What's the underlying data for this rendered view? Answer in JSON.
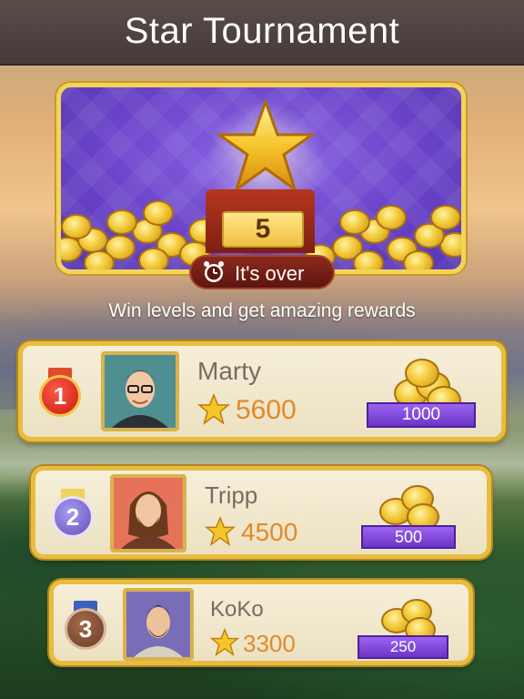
{
  "header": {
    "title": "Star Tournament"
  },
  "banner": {
    "level": "5",
    "status": "It's over",
    "star_icon": "gold-star-icon",
    "clock_icon": "alarm-clock-icon"
  },
  "subtitle": "Win levels and get amazing rewards",
  "leaderboard": [
    {
      "rank": "1",
      "name": "Marty",
      "score": "5600",
      "reward": "1000",
      "medal_color": "#d7261e",
      "ribbon_color": "#e04a2a"
    },
    {
      "rank": "2",
      "name": "Tripp",
      "score": "4500",
      "reward": "500",
      "medal_color": "#7b6cc9",
      "ribbon_color": "#efd35a"
    },
    {
      "rank": "3",
      "name": "KoKo",
      "score": "3300",
      "reward": "250",
      "medal_color": "#7a4c34",
      "ribbon_color": "#3d5fbf"
    }
  ],
  "colors": {
    "accent_gold": "#f4d35c",
    "purple": "#6a43c9",
    "score_orange": "#e08a2a"
  }
}
